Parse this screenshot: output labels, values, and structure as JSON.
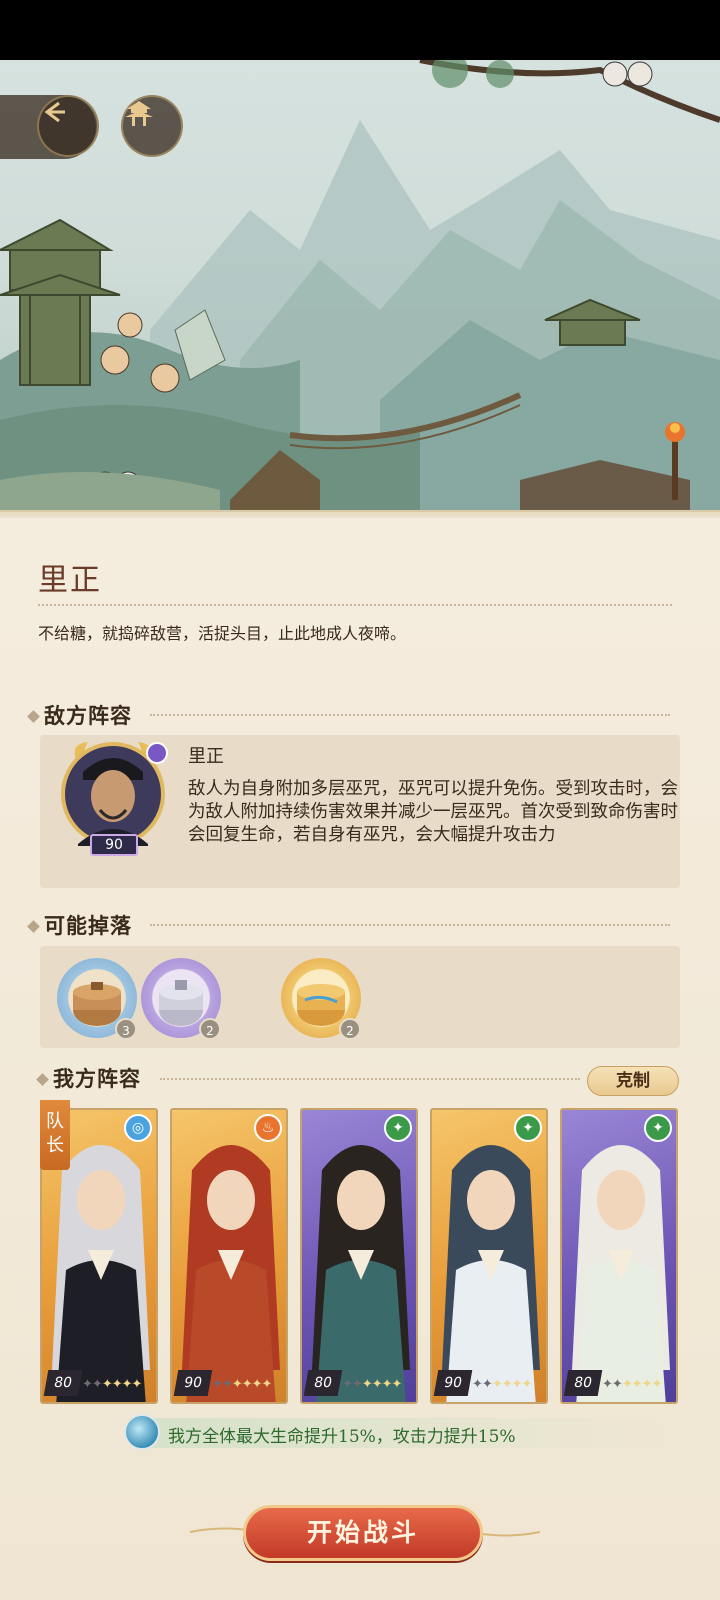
{
  "enemy": {
    "name": "里正",
    "quote": "不给糖，就捣碎敌营，活捉头目，止此地成人夜啼。"
  },
  "enemy_lineup": {
    "title": "敌方阵容",
    "boss": {
      "name": "里正",
      "level": "90",
      "description": "敌人为自身附加多层巫咒，巫咒可以提升免伤。受到攻击时，会为敌人附加持续伤害效果并减少一层巫咒。首次受到致命伤害时会回复生命，若自身有巫咒，会大幅提升攻击力"
    }
  },
  "drops": {
    "title": "可能掉落",
    "items": [
      {
        "icon": "brown-jar-icon",
        "count": "3"
      },
      {
        "icon": "silver-jar-icon",
        "count": "2"
      },
      {
        "icon": "gold-jar-icon",
        "count": "2"
      }
    ]
  },
  "my_lineup": {
    "title": "我方阵容",
    "counter_label": "克制",
    "captain_label": "队长",
    "heroes": [
      {
        "level": "80",
        "element": "water-swirl-icon",
        "element_color": "#4aa3e0",
        "frame": "gold",
        "stars": 4
      },
      {
        "level": "90",
        "element": "fire-icon",
        "element_color": "#e8742e",
        "frame": "gold",
        "stars": 4
      },
      {
        "level": "80",
        "element": "wind-icon",
        "element_color": "#3a9a4a",
        "frame": "purple",
        "stars": 4
      },
      {
        "level": "90",
        "element": "wind-icon",
        "element_color": "#3a9a4a",
        "frame": "gold",
        "stars": 4
      },
      {
        "level": "80",
        "element": "wind-icon",
        "element_color": "#3a9a4a",
        "frame": "purple",
        "stars": 4
      }
    ]
  },
  "buff": {
    "text": "我方全体最大生命提升15%，攻击力提升15%"
  },
  "actions": {
    "start_label": "开始战斗"
  }
}
